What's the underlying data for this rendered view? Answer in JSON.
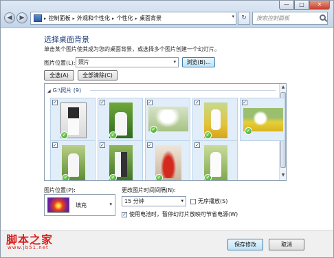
{
  "window": {
    "controls": {
      "minimize": "—",
      "maximize": "□",
      "close": "✕"
    }
  },
  "nav": {
    "back": "◀",
    "forward": "▶",
    "refresh": "↻"
  },
  "address": {
    "crumbs": [
      "控制面板",
      "外观和个性化",
      "个性化",
      "桌面背景"
    ],
    "separator": "▸",
    "dropdown": "▾"
  },
  "search": {
    "placeholder": "搜索控制面板"
  },
  "content": {
    "heading": "选择桌面背景",
    "description": "单击某个图片使其成为您的桌面背景，或选择多个图片创建一个幻灯片。",
    "location_label": "图片位置(L):",
    "location_value": "照片",
    "browse_label": "浏览(B)...",
    "select_all_label": "全选(A)",
    "clear_all_label": "全部清除(C)"
  },
  "gallery": {
    "group_label": "G:\\照片 (9)",
    "collapse_glyph": "◢",
    "thumbnails": [
      {
        "checked": "✓",
        "scene": "indoor"
      },
      {
        "checked": "✓",
        "scene": "garden"
      },
      {
        "checked": "✓",
        "scene": "veil"
      },
      {
        "checked": "✓",
        "scene": "flowers"
      },
      {
        "checked": "✓",
        "scene": "field"
      },
      {
        "checked": "✓",
        "scene": "garden"
      },
      {
        "checked": "✓",
        "scene": "garden"
      },
      {
        "checked": "✓",
        "scene": "red-dress"
      },
      {
        "checked": "✓",
        "scene": "meadow"
      }
    ]
  },
  "options": {
    "position_label": "图片位置(P):",
    "position_value": "填充",
    "interval_label": "更改图片时间间隔(N):",
    "interval_value": "15 分钟",
    "shuffle_label": "无序播放(S)",
    "shuffle_checked": "",
    "battery_label": "使用电池时，暂停幻灯片放映可节省电源(W)",
    "battery_checked": "✓"
  },
  "footer": {
    "save_label": "保存修改",
    "cancel_label": "取消"
  },
  "watermark": {
    "site_name": "脚本之家",
    "url": "www.jb51.net"
  },
  "colors": {
    "accent": "#1f3f7f",
    "selection": "#e1edf8",
    "ok_badge": "#2f9a1c",
    "watermark": "#d8201c"
  }
}
